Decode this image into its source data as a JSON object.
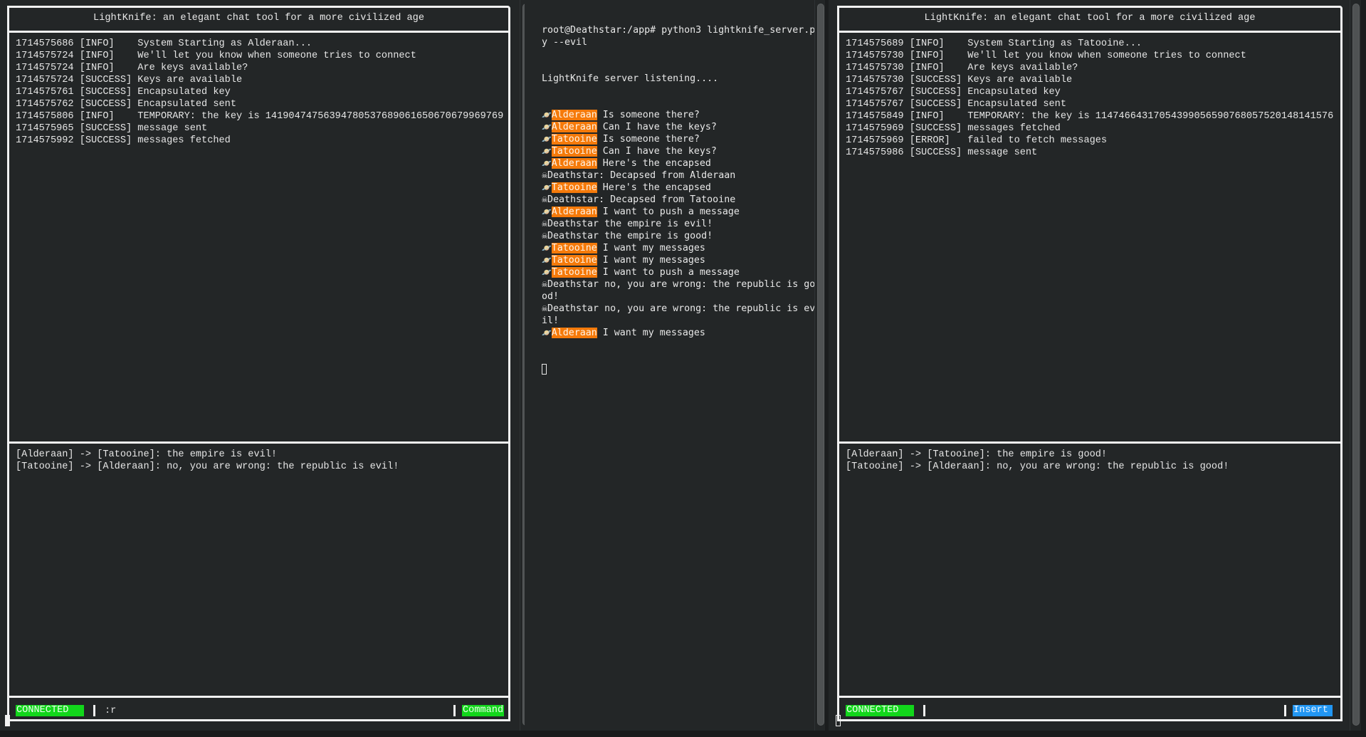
{
  "app_title": "LightKnife: an elegant chat tool for a more civilized age",
  "left_client": {
    "logs": [
      "1714575686 [INFO]    System Starting as Alderaan...",
      "1714575724 [INFO]    We'll let you know when someone tries to connect",
      "1714575724 [INFO]    Are keys available?",
      "1714575724 [SUCCESS] Keys are available",
      "1714575761 [SUCCESS] Encapsulated key",
      "1714575762 [SUCCESS] Encapsulated sent",
      "1714575806 [INFO]    TEMPORARY: the key is 14190474756394780537689061650670679969769",
      "1714575965 [SUCCESS] message sent",
      "1714575992 [SUCCESS] messages fetched"
    ],
    "messages": [
      "[Alderaan] -> [Tatooine]: the empire is evil!",
      "[Tatooine] -> [Alderaan]: no, you are wrong: the republic is evil!"
    ],
    "status": "CONNECTED",
    "input_value": ":r",
    "mode": "Command"
  },
  "server": {
    "command": "root@Deathstar:/app# python3 lightknife_server.py --evil",
    "listening": "LightKnife server listening....",
    "lines": [
      {
        "icon": "planet",
        "name": "Alderaan",
        "text": " Is someone there?"
      },
      {
        "icon": "planet",
        "name": "Alderaan",
        "text": " Can I have the keys?"
      },
      {
        "icon": "planet",
        "name": "Tatooine",
        "text": " Is someone there?"
      },
      {
        "icon": "planet",
        "name": "Tatooine",
        "text": " Can I have the keys?"
      },
      {
        "icon": "planet",
        "name": "Alderaan",
        "text": " Here's the encapsed"
      },
      {
        "icon": "skull",
        "name": "Deathstar",
        "text": ": Decapsed from Alderaan"
      },
      {
        "icon": "planet",
        "name": "Tatooine",
        "text": " Here's the encapsed"
      },
      {
        "icon": "skull",
        "name": "Deathstar",
        "text": ": Decapsed from Tatooine"
      },
      {
        "icon": "planet",
        "name": "Alderaan",
        "text": " I want to push a message"
      },
      {
        "icon": "skull",
        "name": "Deathstar",
        "text": " the empire is evil!"
      },
      {
        "icon": "skull",
        "name": "Deathstar",
        "text": " the empire is good!"
      },
      {
        "icon": "planet",
        "name": "Tatooine",
        "text": " I want my messages"
      },
      {
        "icon": "planet",
        "name": "Tatooine",
        "text": " I want my messages"
      },
      {
        "icon": "planet",
        "name": "Tatooine",
        "text": " I want to push a message"
      },
      {
        "icon": "skull",
        "name": "Deathstar",
        "text": " no, you are wrong: the republic is good!"
      },
      {
        "icon": "skull",
        "name": "Deathstar",
        "text": " no, you are wrong: the republic is evil!"
      },
      {
        "icon": "planet",
        "name": "Alderaan",
        "text": " I want my messages"
      }
    ],
    "highlight_color": "#f57a0a"
  },
  "right_client": {
    "logs": [
      "1714575689 [INFO]    System Starting as Tatooine...",
      "1714575730 [INFO]    We'll let you know when someone tries to connect",
      "1714575730 [INFO]    Are keys available?",
      "1714575730 [SUCCESS] Keys are available",
      "1714575767 [SUCCESS] Encapsulated key",
      "1714575767 [SUCCESS] Encapsulated sent",
      "1714575849 [INFO]    TEMPORARY: the key is 11474664317054399056590768057520148141576",
      "1714575969 [SUCCESS] messages fetched",
      "1714575969 [ERROR]   failed to fetch messages",
      "1714575986 [SUCCESS] message sent"
    ],
    "messages": [
      "[Alderaan] -> [Tatooine]: the empire is good!",
      "[Tatooine] -> [Alderaan]: no, you are wrong: the republic is good!"
    ],
    "status": "CONNECTED",
    "input_value": "",
    "mode": "Insert"
  },
  "colors": {
    "connected": "#12d61b",
    "command_mode": "#12d61b",
    "insert_mode": "#2196f3",
    "background": "#232627"
  }
}
